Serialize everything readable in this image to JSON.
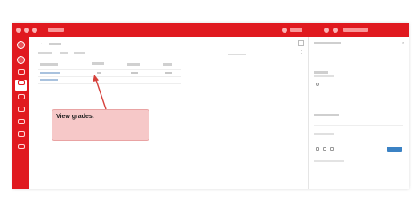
{
  "callout": {
    "text": "View grades."
  },
  "colors": {
    "brand_red": "#e0191f",
    "callout_fill": "#f6c8c8",
    "callout_arrow": "#d6413b",
    "link_blue": "#3b82c4"
  },
  "icons": [
    "logo-icon",
    "account-icon",
    "dashboard-icon",
    "courses-icon",
    "calendar-icon",
    "inbox-icon",
    "history-icon",
    "help-icon",
    "back-icon",
    "more-icon",
    "close-icon",
    "rubric-icon",
    "attach-icon",
    "media-icon"
  ]
}
